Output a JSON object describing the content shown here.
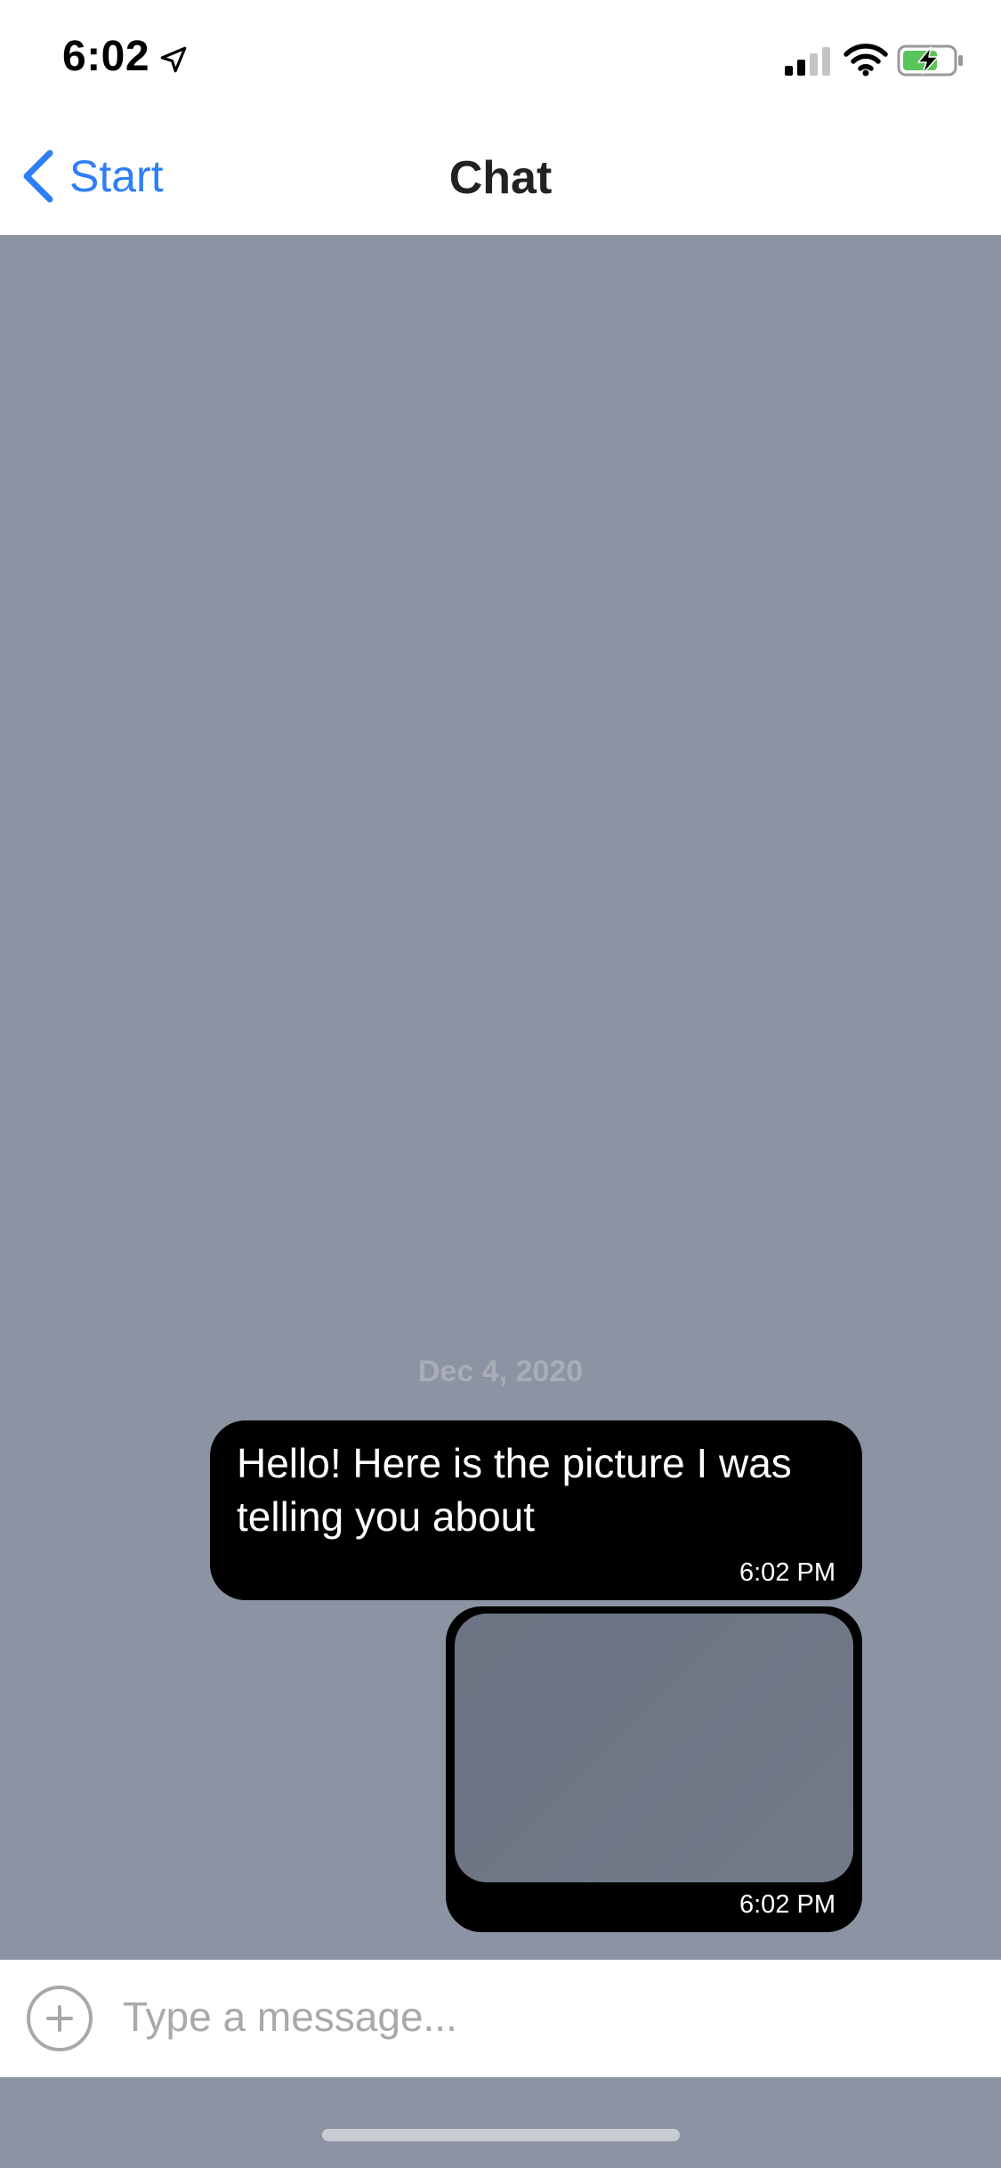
{
  "status_bar": {
    "time": "6:02",
    "icons": {
      "location": "location-arrow-icon",
      "signal": "cellular-signal-icon",
      "wifi": "wifi-icon",
      "battery": "battery-charging-icon"
    }
  },
  "nav": {
    "back_label": "Start",
    "title": "Chat"
  },
  "conversation": {
    "date_separator": "Dec 4, 2020",
    "messages": [
      {
        "type": "text",
        "text": "Hello! Here is the picture I was telling you about",
        "time": "6:02 PM"
      },
      {
        "type": "image",
        "time": "6:02 PM"
      }
    ]
  },
  "composer": {
    "placeholder": "Type a message...",
    "value": ""
  },
  "colors": {
    "accent": "#2f7ef6",
    "chat_background": "#8c93a3",
    "bubble": "#000000",
    "battery_fill": "#5ac35a"
  }
}
